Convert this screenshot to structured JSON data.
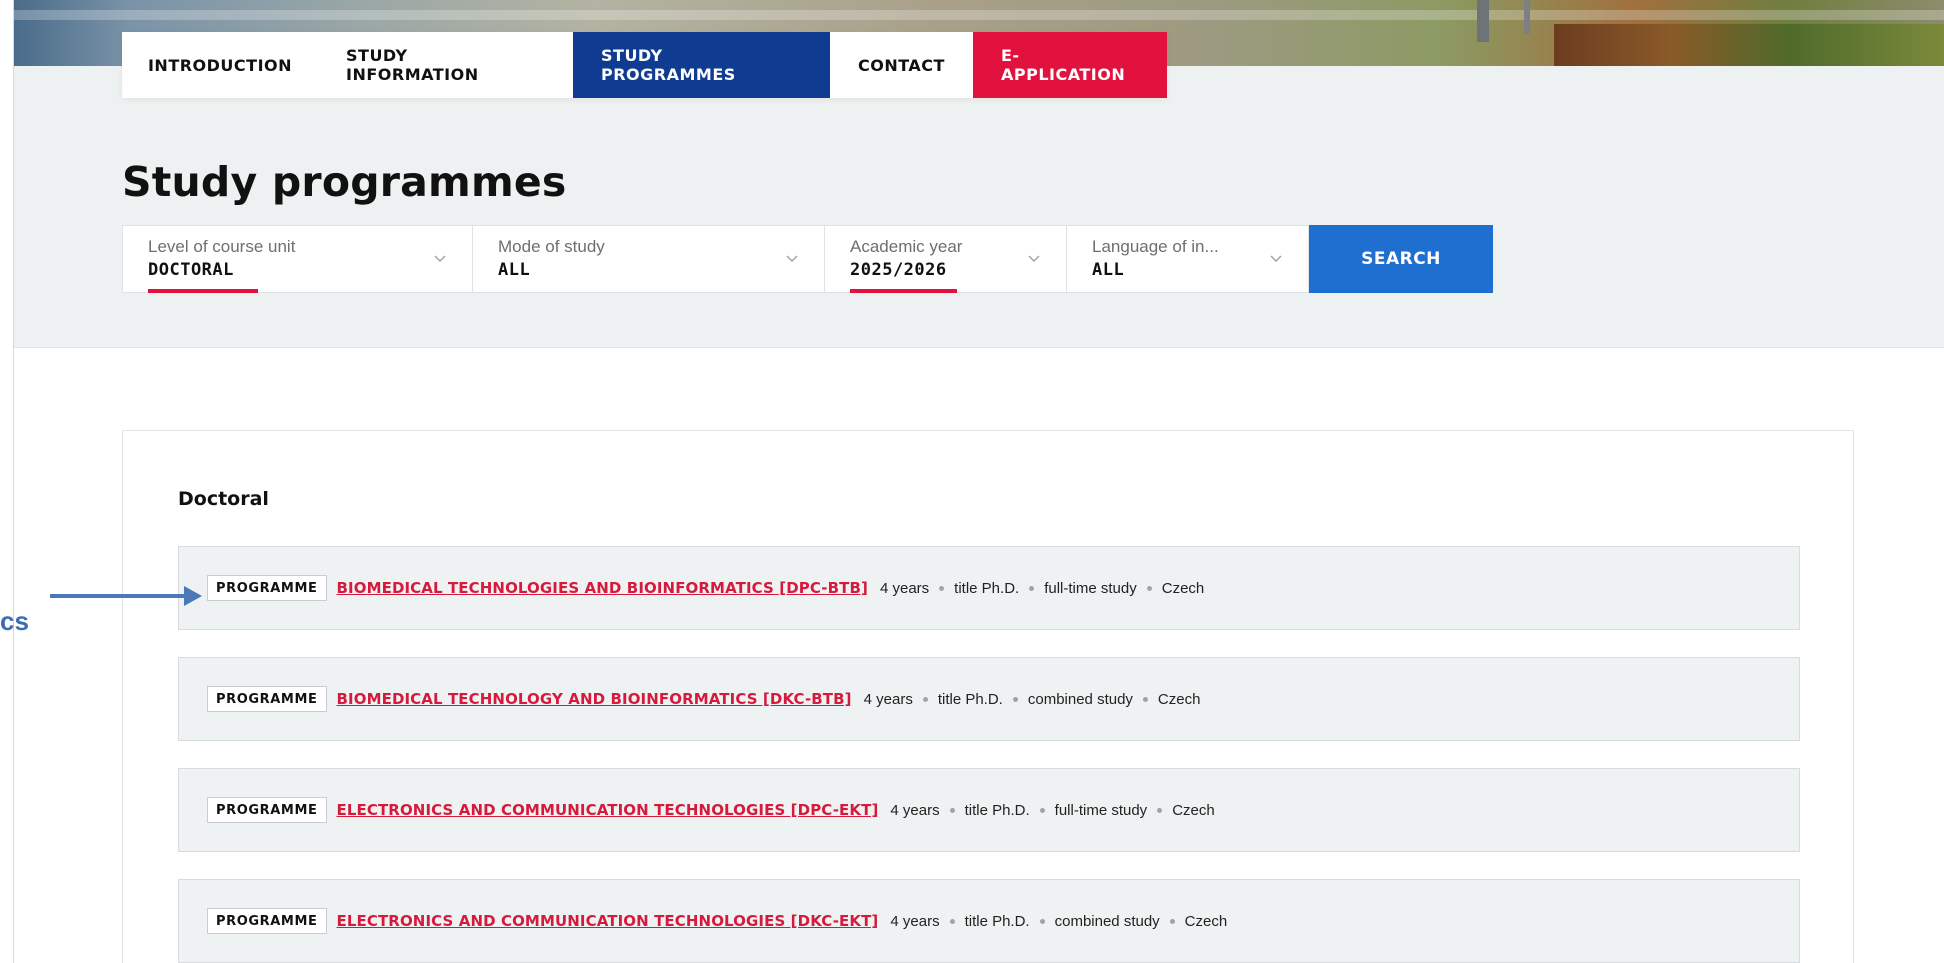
{
  "nav": {
    "tabs": [
      {
        "label": "INTRODUCTION"
      },
      {
        "label": "STUDY INFORMATION"
      },
      {
        "label": "STUDY PROGRAMMES",
        "active": true
      },
      {
        "label": "CONTACT"
      },
      {
        "label": "E-APPLICATION"
      }
    ]
  },
  "page": {
    "title": "Study programmes"
  },
  "filters": [
    {
      "label": "Level of course unit",
      "value": "DOCTORAL",
      "highlighted": true
    },
    {
      "label": "Mode of study",
      "value": "ALL"
    },
    {
      "label": "Academic year",
      "value": "2025/2026",
      "highlighted": true
    },
    {
      "label": "Language of in...",
      "value": "ALL"
    }
  ],
  "search": {
    "label": "SEARCH"
  },
  "results": {
    "section_title": "Doctoral",
    "badge": "PROGRAMME",
    "rows": [
      {
        "name": "BIOMEDICAL TECHNOLOGIES AND BIOINFORMATICS [DPC-BTB]",
        "duration": "4 years",
        "title": "title Ph.D.",
        "mode": "full-time study",
        "language": "Czech"
      },
      {
        "name": "BIOMEDICAL TECHNOLOGY AND BIOINFORMATICS [DKC-BTB]",
        "duration": "4 years",
        "title": "title Ph.D.",
        "mode": "combined study",
        "language": "Czech"
      },
      {
        "name": "ELECTRONICS AND COMMUNICATION TECHNOLOGIES [DPC-EKT]",
        "duration": "4 years",
        "title": "title Ph.D.",
        "mode": "full-time study",
        "language": "Czech"
      },
      {
        "name": "ELECTRONICS AND COMMUNICATION TECHNOLOGIES [DKC-EKT]",
        "duration": "4 years",
        "title": "title Ph.D.",
        "mode": "combined study",
        "language": "Czech"
      }
    ]
  },
  "annotation": {
    "text": "cs",
    "arrow_icon": "arrow-right-icon"
  },
  "colors": {
    "active_tab": "#0f3c91",
    "apply_tab": "#e2123e",
    "search_button": "#1f6fd1",
    "link": "#d51a3d",
    "underline_highlight": "#e2123e",
    "annotation": "#3c6db0"
  }
}
